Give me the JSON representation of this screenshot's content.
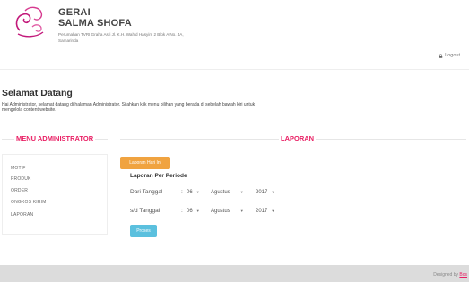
{
  "header": {
    "brand_line1": "GERAI",
    "brand_line2": "SALMA SHOFA",
    "address_line1": "Perumahan TVRI Graha Asri Jl. K.H. Wahid Hasyim 2 Blok A No. 4A,",
    "address_line2": "Samarinda",
    "logout_label": "Logout",
    "logo_icon": "floral-swirl-logo",
    "logo_color": "#c2187a"
  },
  "welcome": {
    "title": "Selamat Datang",
    "text_line1": "Hai Administrator, selamat datang di halaman Administrator. Silahkan klik menu pilihan yang berada di sebelah bawah kiri untuk",
    "text_line2": "mengelola content website."
  },
  "sidebar": {
    "title": "MENU ADMINISTRATOR",
    "items": [
      {
        "label": "MOTIF"
      },
      {
        "label": "PRODUK"
      },
      {
        "label": "ORDER"
      },
      {
        "label": "ONGKOS KIRIM"
      },
      {
        "label": "LAPORAN"
      }
    ]
  },
  "report": {
    "title": "LAPORAN",
    "today_button": "Laporan Hari Ini",
    "period_heading": "Laporan Per Periode",
    "from_label": "Dari Tanggal",
    "to_label": "s/d Tanggal",
    "colon": ":",
    "from_day": "06",
    "from_month": "Agustus",
    "from_year": "2017",
    "to_day": "06",
    "to_month": "Agustus",
    "to_year": "2017",
    "submit_button": "Proses"
  },
  "footer": {
    "designed_prefix": "Designed by",
    "designed_by": "Bos"
  },
  "colors": {
    "accent": "#e91e63",
    "orange_button": "#f0a340",
    "blue_button": "#5bc0de",
    "footer_bg": "#dcdcdc"
  }
}
